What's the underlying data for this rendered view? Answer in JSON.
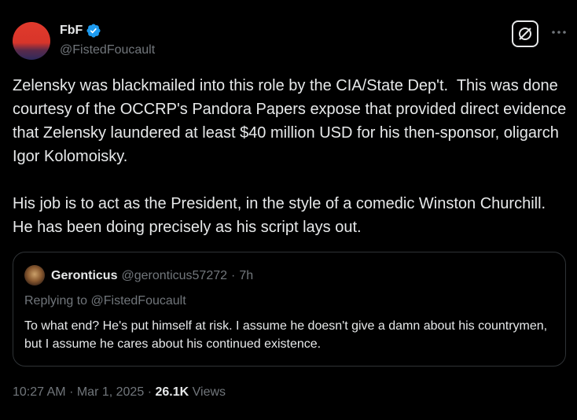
{
  "author": {
    "display_name": "FbF",
    "handle": "@FistedFoucault",
    "verified": true
  },
  "icons": {
    "verified": "verified-badge-icon",
    "grok": "grok-icon",
    "more": "more-options-icon"
  },
  "tweet": {
    "text": "Zelensky was blackmailed into this role by the CIA/State Dep't.  This was done courtesy of the OCCRP's Pandora Papers expose that provided direct evidence that Zelensky laundered at least $40 million USD for his then-sponsor, oligarch Igor Kolomoisky.\n\nHis job is to act as the President, in the style of a comedic Winston Churchill.  He has been doing precisely as his script lays out."
  },
  "quote": {
    "display_name": "Geronticus",
    "handle": "@geronticus57272",
    "separator": "·",
    "time": "7h",
    "replying_to": "Replying to @FistedFoucault",
    "text": "To what end? He's put himself at risk. I assume he doesn't give a damn about his countrymen, but I assume he cares about his continued existence."
  },
  "footer": {
    "time": "10:27 AM",
    "date": "Mar 1, 2025",
    "separator": "·",
    "views_count": "26.1K",
    "views_label": "Views"
  },
  "colors": {
    "background": "#000000",
    "text_primary": "#e7e9ea",
    "text_secondary": "#71767b",
    "verified_blue": "#1d9bf0",
    "border": "#2f3336"
  }
}
